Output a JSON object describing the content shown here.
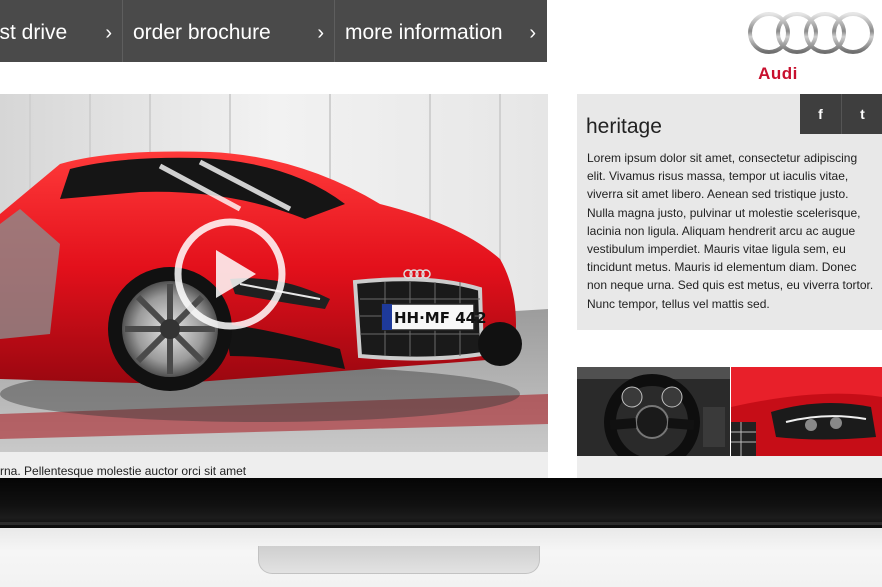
{
  "nav": {
    "items": [
      {
        "label": "test drive",
        "chevron": "›"
      },
      {
        "label": "order brochure",
        "chevron": "›"
      },
      {
        "label": "more information",
        "chevron": "›"
      }
    ]
  },
  "brand": {
    "name": "Audi",
    "logo_icon": "four-rings-logo",
    "accent_color": "#c8102e"
  },
  "hero": {
    "play_icon": "play-icon",
    "plate_text": "HH·MF 442",
    "caption": "rna. Pellentesque molestie auctor orci sit amet"
  },
  "heritage": {
    "title": "heritage",
    "body": "Lorem ipsum dolor sit amet, consectetur adipiscing elit. Vivamus risus massa, tempor ut iaculis vitae, viverra sit amet libero. Aenean sed tristique justo. Nulla magna justo, pulvinar ut molestie scelerisque, lacinia non ligula. Aliquam hendrerit arcu ac augue vestibulum imperdiet. Mauris vitae ligula sem, eu tincidunt metus. Mauris id elementum diam. Donec non neque urna. Sed quis est metus, eu viverra tortor. Nunc tempor, tellus vel mattis sed.",
    "facebook_glyph": "f",
    "twitter_glyph": "t"
  },
  "thumbnails": [
    {
      "icon": "steering-wheel-thumbnail"
    },
    {
      "icon": "headlight-thumbnail"
    }
  ]
}
